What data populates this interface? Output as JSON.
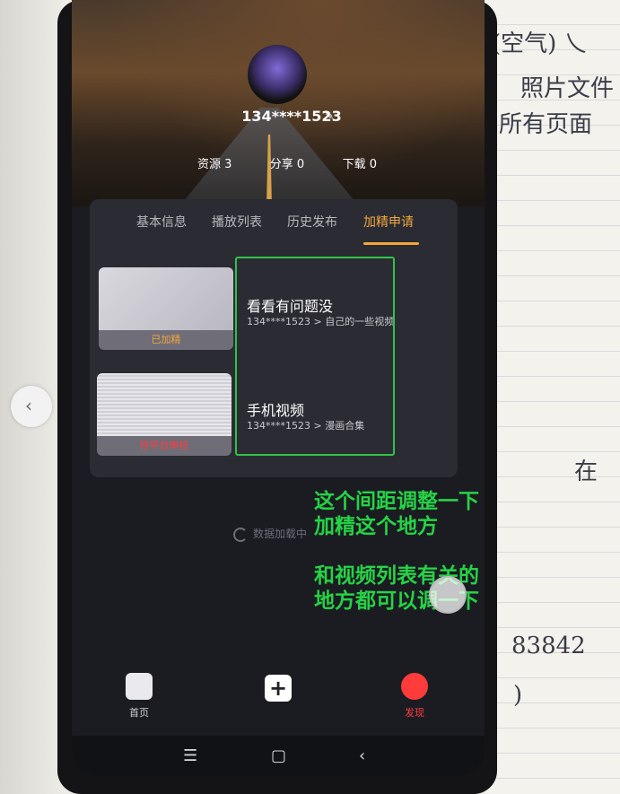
{
  "profile": {
    "username": "134****1523"
  },
  "stats": [
    {
      "label": "资源 3"
    },
    {
      "label": "分享 0"
    },
    {
      "label": "下载 0"
    }
  ],
  "tabs": [
    {
      "label": "基本信息",
      "active": false
    },
    {
      "label": "播放列表",
      "active": false
    },
    {
      "label": "历史发布",
      "active": false
    },
    {
      "label": "加精申请",
      "active": true
    }
  ],
  "items": [
    {
      "status": "已加精",
      "status_color": "#f3a63c",
      "title": "看看有问题没",
      "subtitle": "134****1523 > 自己的一些视频"
    },
    {
      "status": "待平台审核",
      "status_color": "#ff3b3b",
      "title": "手机视频",
      "subtitle": "134****1523 > 漫画合集"
    }
  ],
  "loading_text": "数据加载中",
  "nav": [
    {
      "label": "首页",
      "icon": "home-icon"
    },
    {
      "label": "",
      "icon": "plus-icon"
    },
    {
      "label": "发现",
      "icon": "planet-icon",
      "active_color": "#ff3b3b"
    }
  ],
  "annotations": [
    "这个间距调整一下",
    "加精这个地方",
    "和视频列表有关的",
    "地方都可以调一下"
  ],
  "notebook": [
    "(空气) 乀",
    "照片文件",
    "所有页面",
    "在",
    "83842",
    ")"
  ],
  "colors": {
    "accent": "#f3a63c",
    "annotation": "#26d246",
    "danger": "#ff3b3b"
  }
}
